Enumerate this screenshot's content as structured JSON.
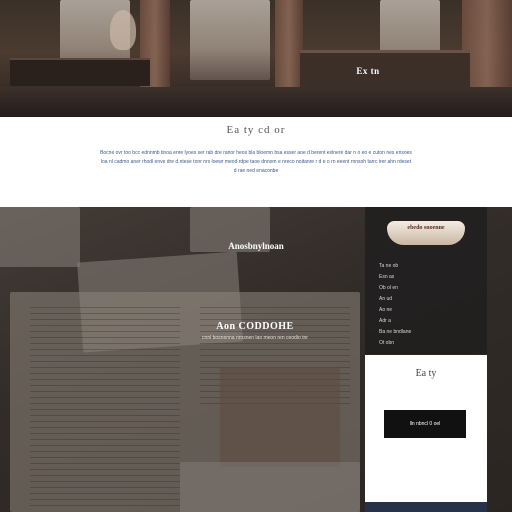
{
  "hero": {
    "text": "Ex tn"
  },
  "intro": {
    "title": "Ea ty cd or",
    "paragraph": "Bocne ovr too bcc ednnmb tinoa enre lyoes ser rab dre ranor heos bla bloemn bsa esser aoe d berent exlnere dar n o eo e cuton nes ensoes loa nl cadmo aner rhodl enve dre d.ntese tonr nrs loewr meod rdpe taoe dnnom e nreco noitanre r d e o rn eeent rnnsoh tarrc irer ahn rdeset d rae ned enaconbe"
  },
  "books": {
    "heading_top": "Anosbnylnoan",
    "heading_main": "Aon CODDOHE",
    "subheading_main": "cnnl bosnenna nrosnen lao meon ren ceodio tnr"
  },
  "card_dark": {
    "badge": "ebedo snoenne",
    "list": [
      "Ta ne ob",
      "Esn as",
      "Ob ol en",
      "An ud",
      "Ao ne",
      "Adr a",
      "Ba ne bndlane",
      "Ot obn"
    ]
  },
  "card_light": {
    "title": "Ea ty",
    "button": "lln nbncl 0 oel"
  }
}
